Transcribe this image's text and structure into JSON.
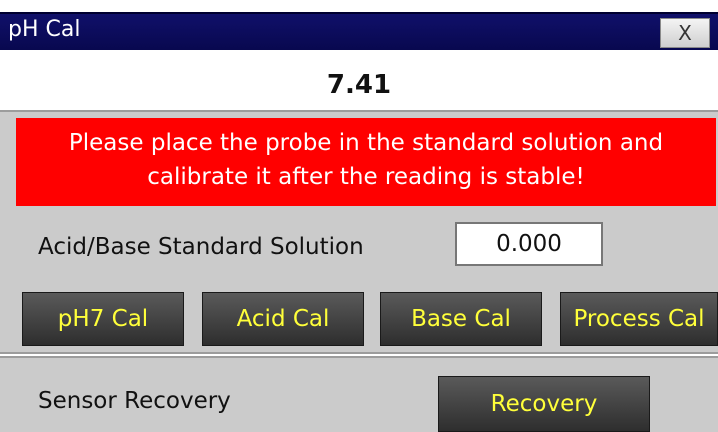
{
  "window": {
    "title": "pH Cal",
    "close_label": "X"
  },
  "reading": {
    "value": "7.41"
  },
  "warning": {
    "line1": "Please place the probe in the standard solution and",
    "line2": "calibrate it after the reading is stable!"
  },
  "standard_solution": {
    "label": "Acid/Base Standard Solution",
    "value": "0.000"
  },
  "cal_buttons": [
    "pH7 Cal",
    "Acid Cal",
    "Base Cal",
    "Process Cal"
  ],
  "recovery": {
    "label": "Sensor Recovery",
    "button_label": "Recovery"
  },
  "colors": {
    "titlebar": "#08084f",
    "warning_bg": "#ff0000",
    "panel_bg": "#cbcbcb",
    "button_text": "#ffff3a",
    "button_bg": "#3a3a3a"
  }
}
